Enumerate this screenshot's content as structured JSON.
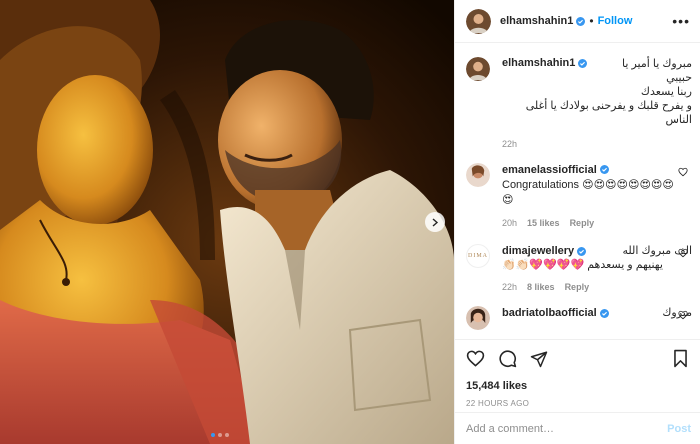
{
  "post": {
    "username": "elhamshahin1",
    "follow_label": "Follow",
    "more_label": "•••",
    "caption": {
      "username": "elhamshahin1",
      "text_line1": "مبروك يا أمير يا حبيبي",
      "text_line2": "ربنا يسعدك",
      "text_line3": "و يفرح قلبك و يفرحنى بولادك يا أغلى الناس",
      "time": "22h"
    },
    "comments": [
      {
        "username": "emanelassiofficial",
        "text": "Congratulations 😍😍😍😍😍😍😍😍😍",
        "time": "20h",
        "likes": "15 likes",
        "reply": "Reply"
      },
      {
        "username": "dimajewellery",
        "text_rtl": "الف مبروك الله",
        "text_line2": "يهنيهم و يسعدهم 💖💖💖💖👏🏻👏🏻",
        "avatar_text": "DIMA",
        "time": "22h",
        "likes": "8 likes",
        "reply": "Reply"
      },
      {
        "username": "badriatolbaofficial",
        "text_rtl": "مبروك"
      }
    ],
    "likes": "15,484 likes",
    "ago": "22 HOURS AGO",
    "add_comment_placeholder": "Add a comment…",
    "post_label": "Post",
    "carousel": {
      "count": 3,
      "active": 0
    },
    "colors": {
      "accent": "#0095f6",
      "verified": "#3897f0",
      "post_disabled": "#b2dffc"
    }
  }
}
